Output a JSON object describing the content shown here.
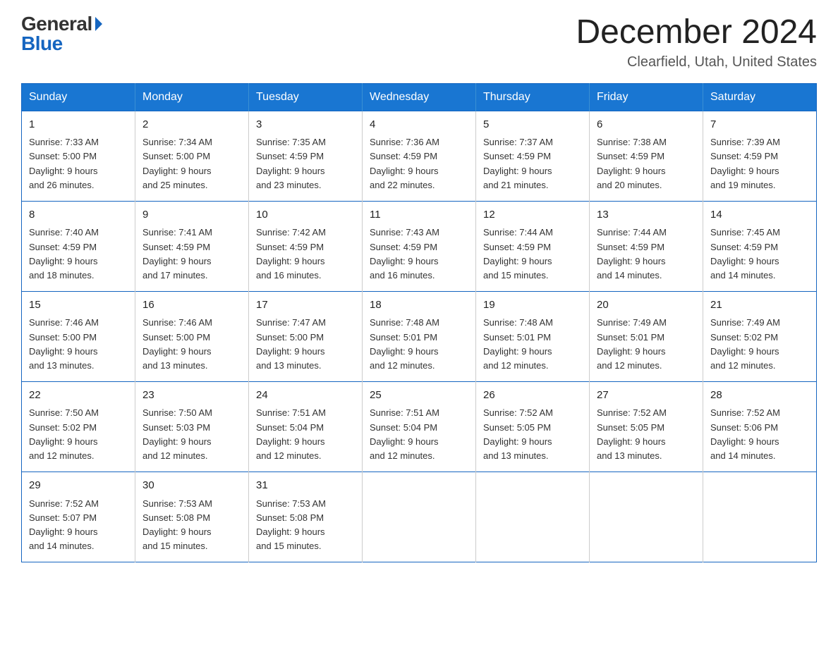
{
  "header": {
    "logo_general": "General",
    "logo_blue": "Blue",
    "month_title": "December 2024",
    "location": "Clearfield, Utah, United States"
  },
  "days_of_week": [
    "Sunday",
    "Monday",
    "Tuesday",
    "Wednesday",
    "Thursday",
    "Friday",
    "Saturday"
  ],
  "weeks": [
    [
      {
        "day": "1",
        "sunrise": "7:33 AM",
        "sunset": "5:00 PM",
        "daylight": "9 hours and 26 minutes."
      },
      {
        "day": "2",
        "sunrise": "7:34 AM",
        "sunset": "5:00 PM",
        "daylight": "9 hours and 25 minutes."
      },
      {
        "day": "3",
        "sunrise": "7:35 AM",
        "sunset": "4:59 PM",
        "daylight": "9 hours and 23 minutes."
      },
      {
        "day": "4",
        "sunrise": "7:36 AM",
        "sunset": "4:59 PM",
        "daylight": "9 hours and 22 minutes."
      },
      {
        "day": "5",
        "sunrise": "7:37 AM",
        "sunset": "4:59 PM",
        "daylight": "9 hours and 21 minutes."
      },
      {
        "day": "6",
        "sunrise": "7:38 AM",
        "sunset": "4:59 PM",
        "daylight": "9 hours and 20 minutes."
      },
      {
        "day": "7",
        "sunrise": "7:39 AM",
        "sunset": "4:59 PM",
        "daylight": "9 hours and 19 minutes."
      }
    ],
    [
      {
        "day": "8",
        "sunrise": "7:40 AM",
        "sunset": "4:59 PM",
        "daylight": "9 hours and 18 minutes."
      },
      {
        "day": "9",
        "sunrise": "7:41 AM",
        "sunset": "4:59 PM",
        "daylight": "9 hours and 17 minutes."
      },
      {
        "day": "10",
        "sunrise": "7:42 AM",
        "sunset": "4:59 PM",
        "daylight": "9 hours and 16 minutes."
      },
      {
        "day": "11",
        "sunrise": "7:43 AM",
        "sunset": "4:59 PM",
        "daylight": "9 hours and 16 minutes."
      },
      {
        "day": "12",
        "sunrise": "7:44 AM",
        "sunset": "4:59 PM",
        "daylight": "9 hours and 15 minutes."
      },
      {
        "day": "13",
        "sunrise": "7:44 AM",
        "sunset": "4:59 PM",
        "daylight": "9 hours and 14 minutes."
      },
      {
        "day": "14",
        "sunrise": "7:45 AM",
        "sunset": "4:59 PM",
        "daylight": "9 hours and 14 minutes."
      }
    ],
    [
      {
        "day": "15",
        "sunrise": "7:46 AM",
        "sunset": "5:00 PM",
        "daylight": "9 hours and 13 minutes."
      },
      {
        "day": "16",
        "sunrise": "7:46 AM",
        "sunset": "5:00 PM",
        "daylight": "9 hours and 13 minutes."
      },
      {
        "day": "17",
        "sunrise": "7:47 AM",
        "sunset": "5:00 PM",
        "daylight": "9 hours and 13 minutes."
      },
      {
        "day": "18",
        "sunrise": "7:48 AM",
        "sunset": "5:01 PM",
        "daylight": "9 hours and 12 minutes."
      },
      {
        "day": "19",
        "sunrise": "7:48 AM",
        "sunset": "5:01 PM",
        "daylight": "9 hours and 12 minutes."
      },
      {
        "day": "20",
        "sunrise": "7:49 AM",
        "sunset": "5:01 PM",
        "daylight": "9 hours and 12 minutes."
      },
      {
        "day": "21",
        "sunrise": "7:49 AM",
        "sunset": "5:02 PM",
        "daylight": "9 hours and 12 minutes."
      }
    ],
    [
      {
        "day": "22",
        "sunrise": "7:50 AM",
        "sunset": "5:02 PM",
        "daylight": "9 hours and 12 minutes."
      },
      {
        "day": "23",
        "sunrise": "7:50 AM",
        "sunset": "5:03 PM",
        "daylight": "9 hours and 12 minutes."
      },
      {
        "day": "24",
        "sunrise": "7:51 AM",
        "sunset": "5:04 PM",
        "daylight": "9 hours and 12 minutes."
      },
      {
        "day": "25",
        "sunrise": "7:51 AM",
        "sunset": "5:04 PM",
        "daylight": "9 hours and 12 minutes."
      },
      {
        "day": "26",
        "sunrise": "7:52 AM",
        "sunset": "5:05 PM",
        "daylight": "9 hours and 13 minutes."
      },
      {
        "day": "27",
        "sunrise": "7:52 AM",
        "sunset": "5:05 PM",
        "daylight": "9 hours and 13 minutes."
      },
      {
        "day": "28",
        "sunrise": "7:52 AM",
        "sunset": "5:06 PM",
        "daylight": "9 hours and 14 minutes."
      }
    ],
    [
      {
        "day": "29",
        "sunrise": "7:52 AM",
        "sunset": "5:07 PM",
        "daylight": "9 hours and 14 minutes."
      },
      {
        "day": "30",
        "sunrise": "7:53 AM",
        "sunset": "5:08 PM",
        "daylight": "9 hours and 15 minutes."
      },
      {
        "day": "31",
        "sunrise": "7:53 AM",
        "sunset": "5:08 PM",
        "daylight": "9 hours and 15 minutes."
      },
      null,
      null,
      null,
      null
    ]
  ],
  "labels": {
    "sunrise": "Sunrise:",
    "sunset": "Sunset:",
    "daylight": "Daylight:"
  }
}
